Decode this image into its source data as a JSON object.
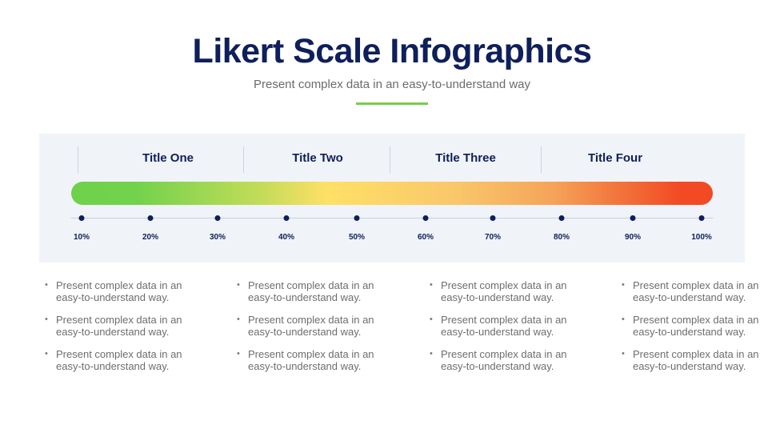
{
  "header": {
    "title": "Likert Scale Infographics",
    "subtitle": "Present complex data in an easy-to-understand way",
    "accent_color": "#7ccb4f"
  },
  "scale": {
    "columns": [
      {
        "title": "Title One"
      },
      {
        "title": "Title Two"
      },
      {
        "title": "Title Three"
      },
      {
        "title": "Title Four"
      }
    ],
    "gradient_stops": [
      {
        "pos": 0,
        "color": "#6fd14a"
      },
      {
        "pos": 0.1,
        "color": "#72d24c"
      },
      {
        "pos": 0.3,
        "color": "#c5dc58"
      },
      {
        "pos": 0.4,
        "color": "#ffe066"
      },
      {
        "pos": 0.6,
        "color": "#f9c76a"
      },
      {
        "pos": 0.75,
        "color": "#f5a45a"
      },
      {
        "pos": 0.85,
        "color": "#f2763c"
      },
      {
        "pos": 0.95,
        "color": "#f24a24"
      },
      {
        "pos": 1,
        "color": "#f24a24"
      }
    ],
    "ticks": [
      "10%",
      "20%",
      "30%",
      "40%",
      "50%",
      "60%",
      "70%",
      "80%",
      "90%",
      "100%"
    ]
  },
  "descriptions": [
    {
      "items": [
        "Present complex data in an easy-to-understand way.",
        "Present complex data in an easy-to-understand way.",
        "Present complex data in an easy-to-understand way."
      ]
    },
    {
      "items": [
        "Present complex data in an easy-to-understand way.",
        "Present complex data in an easy-to-understand way.",
        "Present complex data in an easy-to-understand way."
      ]
    },
    {
      "items": [
        "Present complex data in an easy-to-understand way.",
        "Present complex data in an easy-to-understand way.",
        "Present complex data in an easy-to-understand way."
      ]
    },
    {
      "items": [
        "Present complex data in an easy-to-understand way.",
        "Present complex data in an easy-to-understand way.",
        "Present complex data in an easy-to-understand way."
      ]
    }
  ],
  "bullet_glyph": "•"
}
